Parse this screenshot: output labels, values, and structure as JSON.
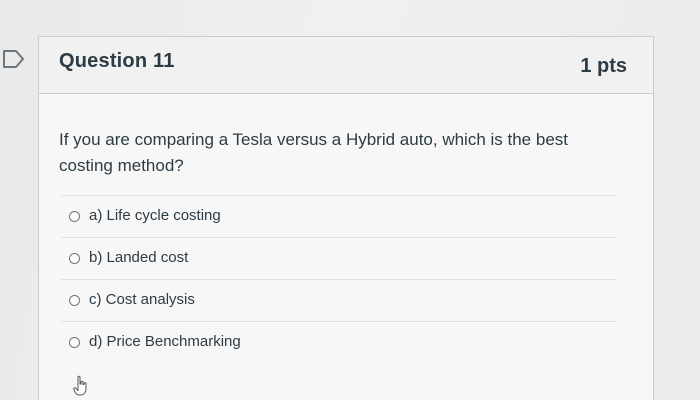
{
  "question": {
    "title": "Question 11",
    "points": "1 pts",
    "text": "If you are comparing a Tesla versus a Hybrid auto, which is the best costing method?",
    "answers": [
      {
        "label": "a) Life cycle costing",
        "selected": false
      },
      {
        "label": "b) Landed cost",
        "selected": false
      },
      {
        "label": "c) Cost analysis",
        "selected": false
      },
      {
        "label": "d) Price Benchmarking",
        "selected": false
      }
    ]
  },
  "icons": {
    "flag": "flag-icon",
    "radio": "radio-unchecked-icon",
    "cursor": "mouse-pointer-hand-icon"
  },
  "colors": {
    "text": "#2d3b45",
    "border": "#c7cdd1",
    "background": "#f7f7f7"
  }
}
